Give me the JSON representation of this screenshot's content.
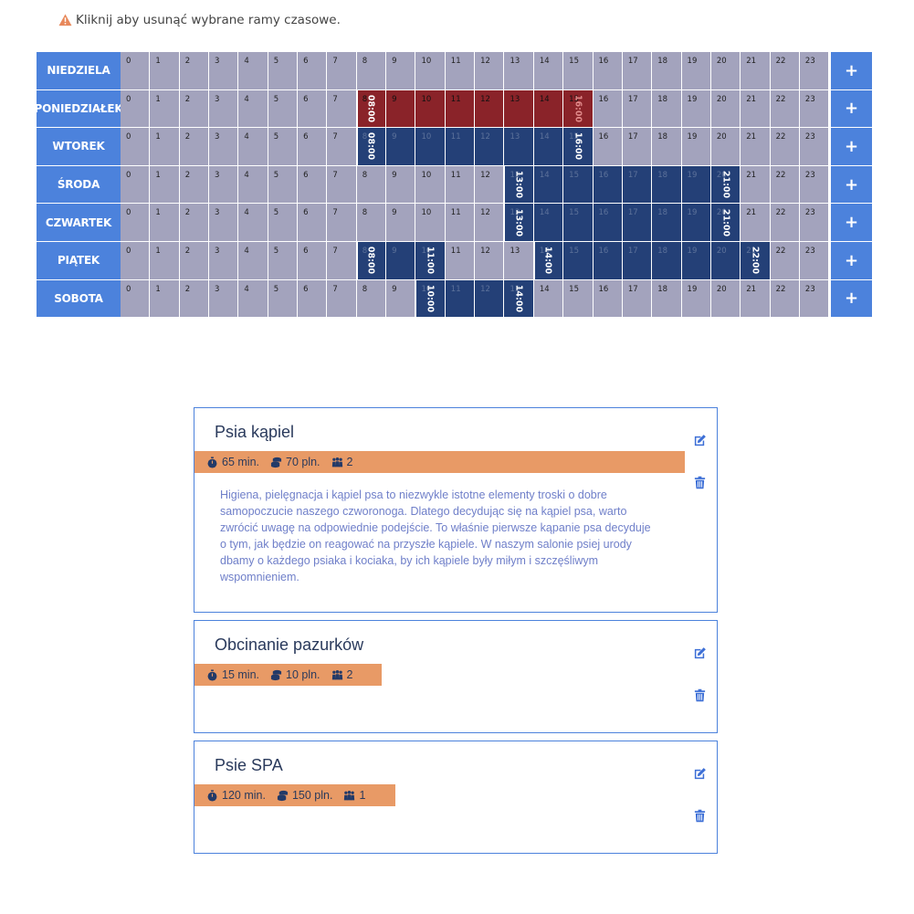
{
  "hint": {
    "text": "Kliknij aby usunąć wybrane ramy czasowe."
  },
  "schedule": {
    "hours": [
      "0",
      "1",
      "2",
      "3",
      "4",
      "5",
      "6",
      "7",
      "8",
      "9",
      "10",
      "11",
      "12",
      "13",
      "14",
      "15",
      "16",
      "17",
      "18",
      "19",
      "20",
      "21",
      "22",
      "23"
    ],
    "add_label": "+",
    "days": [
      {
        "name": "NIEDZIELA",
        "ranges": []
      },
      {
        "name": "PONIEDZIAŁEK",
        "ranges": [
          {
            "start": 8,
            "end": 16,
            "start_label": "08:00",
            "end_label": "16:00",
            "status": "selected"
          }
        ]
      },
      {
        "name": "WTOREK",
        "ranges": [
          {
            "start": 8,
            "end": 16,
            "start_label": "08:00",
            "end_label": "16:00",
            "status": "active"
          }
        ]
      },
      {
        "name": "ŚRODA",
        "ranges": [
          {
            "start": 13,
            "end": 21,
            "start_label": "13:00",
            "end_label": "21:00",
            "status": "active"
          }
        ]
      },
      {
        "name": "CZWARTEK",
        "ranges": [
          {
            "start": 13,
            "end": 21,
            "start_label": "13:00",
            "end_label": "21:00",
            "status": "active"
          }
        ]
      },
      {
        "name": "PIĄTEK",
        "ranges": [
          {
            "start": 8,
            "end": 11,
            "start_label": "08:00",
            "end_label": "11:00",
            "status": "active"
          },
          {
            "start": 14,
            "end": 22,
            "start_label": "14:00",
            "end_label": "22:00",
            "status": "active"
          }
        ]
      },
      {
        "name": "SOBOTA",
        "ranges": [
          {
            "start": 10,
            "end": 14,
            "start_label": "10:00",
            "end_label": "14:00",
            "status": "active"
          }
        ]
      }
    ]
  },
  "colors": {
    "day_bg": "#4c82dc",
    "cell_bg": "#a3a3bd",
    "active": "#244077",
    "selected": "#8a2329",
    "meta_bg": "#e89a66"
  },
  "services": [
    {
      "title": "Psia kąpiel",
      "duration": "65 min.",
      "price": "70 pln.",
      "people": "2",
      "description": "Higiena, pielęgnacja i kąpiel psa to niezwykle istotne elementy troski o dobre samopoczucie naszego czworonoga. Dlatego decydując się na kąpiel psa, warto zwrócić uwagę na odpowiednie podejście. To właśnie pierwsze kąpanie psa decyduje o tym, jak będzie on reagować na przyszłe kąpiele. W naszym salonie psiej urody dbamy o każdego psiaka i kociaka, by ich kąpiele były miłym i szczęśliwym wspomnieniem.",
      "edit_icon": "edit-icon",
      "delete_icon": "trash-icon"
    },
    {
      "title": "Obcinanie pazurków",
      "duration": "15 min.",
      "price": "10 pln.",
      "people": "2",
      "description": "",
      "edit_icon": "edit-icon",
      "delete_icon": "trash-icon"
    },
    {
      "title": "Psie SPA",
      "duration": "120 min.",
      "price": "150 pln.",
      "people": "1",
      "description": "",
      "edit_icon": "edit-icon",
      "delete_icon": "trash-icon"
    }
  ]
}
